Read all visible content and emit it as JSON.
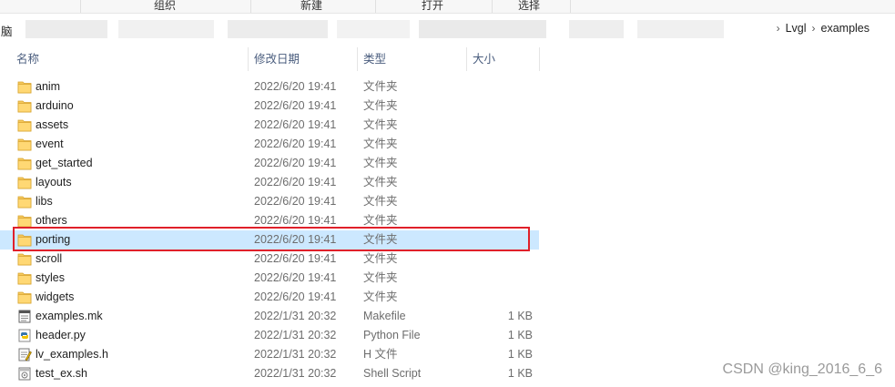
{
  "ribbon": {
    "groups": [
      "组织",
      "新建",
      "打开",
      "选择"
    ]
  },
  "address": {
    "root_fragment": "脑",
    "crumbs": [
      "Lvgl",
      "examples"
    ]
  },
  "columns": {
    "name": "名称",
    "date": "修改日期",
    "type": "类型",
    "size": "大小"
  },
  "files": [
    {
      "name": "anim",
      "date": "2022/6/20 19:41",
      "type": "文件夹",
      "size": "",
      "icon": "folder-icon"
    },
    {
      "name": "arduino",
      "date": "2022/6/20 19:41",
      "type": "文件夹",
      "size": "",
      "icon": "folder-icon"
    },
    {
      "name": "assets",
      "date": "2022/6/20 19:41",
      "type": "文件夹",
      "size": "",
      "icon": "folder-icon"
    },
    {
      "name": "event",
      "date": "2022/6/20 19:41",
      "type": "文件夹",
      "size": "",
      "icon": "folder-icon"
    },
    {
      "name": "get_started",
      "date": "2022/6/20 19:41",
      "type": "文件夹",
      "size": "",
      "icon": "folder-icon"
    },
    {
      "name": "layouts",
      "date": "2022/6/20 19:41",
      "type": "文件夹",
      "size": "",
      "icon": "folder-icon"
    },
    {
      "name": "libs",
      "date": "2022/6/20 19:41",
      "type": "文件夹",
      "size": "",
      "icon": "folder-icon"
    },
    {
      "name": "others",
      "date": "2022/6/20 19:41",
      "type": "文件夹",
      "size": "",
      "icon": "folder-icon"
    },
    {
      "name": "porting",
      "date": "2022/6/20 19:41",
      "type": "文件夹",
      "size": "",
      "icon": "folder-icon",
      "selected": true
    },
    {
      "name": "scroll",
      "date": "2022/6/20 19:41",
      "type": "文件夹",
      "size": "",
      "icon": "folder-icon"
    },
    {
      "name": "styles",
      "date": "2022/6/20 19:41",
      "type": "文件夹",
      "size": "",
      "icon": "folder-icon"
    },
    {
      "name": "widgets",
      "date": "2022/6/20 19:41",
      "type": "文件夹",
      "size": "",
      "icon": "folder-icon"
    },
    {
      "name": "examples.mk",
      "date": "2022/1/31 20:32",
      "type": "Makefile",
      "size": "1 KB",
      "icon": "makefile-icon"
    },
    {
      "name": "header.py",
      "date": "2022/1/31 20:32",
      "type": "Python File",
      "size": "1 KB",
      "icon": "python-file-icon"
    },
    {
      "name": "lv_examples.h",
      "date": "2022/1/31 20:32",
      "type": "H 文件",
      "size": "1 KB",
      "icon": "header-file-icon"
    },
    {
      "name": "test_ex.sh",
      "date": "2022/1/31 20:32",
      "type": "Shell Script",
      "size": "1 KB",
      "icon": "shell-script-icon"
    }
  ],
  "watermark": "CSDN @king_2016_6_6",
  "colors": {
    "selection": "#cce8ff",
    "highlight_box": "#e0202a",
    "header_text": "#4a5d7e",
    "folder": "#f5c85c"
  }
}
